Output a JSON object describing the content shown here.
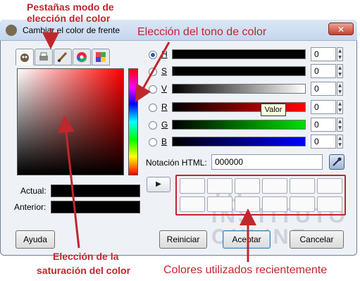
{
  "window": {
    "title": "Cambiar el color de frente",
    "close_glyph": "✕"
  },
  "tabs": [
    {
      "name": "tab-gimp-selector",
      "icon": "wilber-icon"
    },
    {
      "name": "tab-cmyk",
      "icon": "printer-icon"
    },
    {
      "name": "tab-watercolor",
      "icon": "brush-icon"
    },
    {
      "name": "tab-wheel",
      "icon": "color-wheel-icon"
    },
    {
      "name": "tab-palette",
      "icon": "palette-icon"
    }
  ],
  "swatches": {
    "current_label": "Actual:",
    "previous_label": "Anterior:",
    "current_color": "#000000",
    "previous_color": "#000000"
  },
  "channels": [
    {
      "key": "h",
      "letter": "H",
      "value": "0",
      "selected": true
    },
    {
      "key": "s",
      "letter": "S",
      "value": "0",
      "selected": false
    },
    {
      "key": "v",
      "letter": "V",
      "value": "0",
      "selected": false
    },
    {
      "key": "r",
      "letter": "R",
      "value": "0",
      "selected": false
    },
    {
      "key": "g",
      "letter": "G",
      "value": "0",
      "selected": false
    },
    {
      "key": "b",
      "letter": "B",
      "value": "0",
      "selected": false
    }
  ],
  "tooltip": "Valor",
  "html_notation": {
    "label": "Notación HTML:",
    "value": "000000"
  },
  "buttons": {
    "help": "Ayuda",
    "reset": "Reiniciar",
    "accept": "Aceptar",
    "cancel": "Cancelar",
    "expander_glyph": "▶"
  },
  "watermark": "TU INSTITUTO ONLINE",
  "annotations": {
    "tabs": "Pestañas modo de elección del      color",
    "hue": "Elección del tono de color",
    "saturation_line1": "Elección de la",
    "saturation_line2": "saturación del color",
    "recent": "Colores utilizados recientemente"
  },
  "colors": {
    "annotation_red": "#c0272d",
    "accent_blue": "#3c7fb1"
  }
}
